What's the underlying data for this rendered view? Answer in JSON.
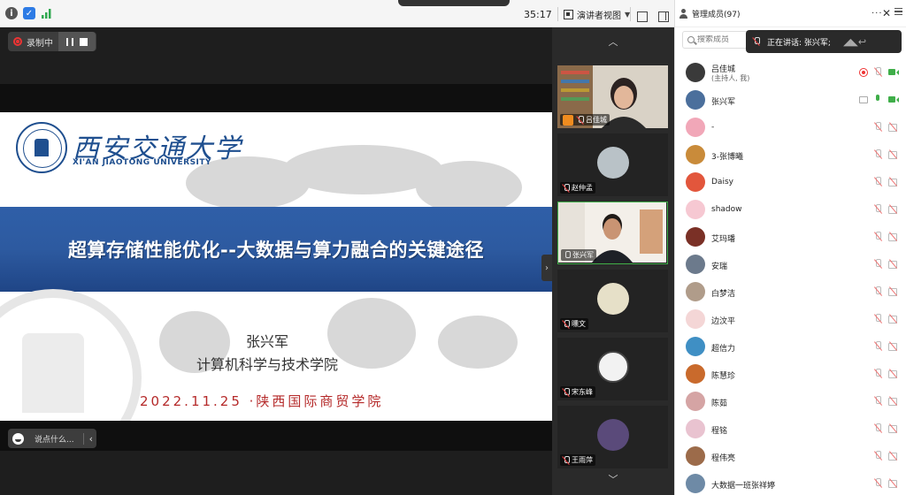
{
  "toolbar": {
    "timer": "35:17",
    "presenter_view_label": "演讲者视图"
  },
  "recording": {
    "label": "录制中"
  },
  "slide": {
    "university_cn": "西安交通大学",
    "university_en": "XI'AN JIAOTONG UNIVERSITY",
    "title": "超算存储性能优化--大数据与算力融合的关键途径",
    "presenter": "张兴军",
    "school": "计算机科学与技术学院",
    "date_venue": "2022.11.25 ·陕西国际商贸学院"
  },
  "chat": {
    "placeholder": "说点什么..."
  },
  "video_tiles": [
    {
      "name": "吕佳城",
      "kind": "video-host"
    },
    {
      "name": "赵仲孟",
      "kind": "avatar"
    },
    {
      "name": "张兴军",
      "kind": "video-active"
    },
    {
      "name": "曛文",
      "kind": "avatar"
    },
    {
      "name": "宋东峰",
      "kind": "avatar"
    },
    {
      "name": "王雨萍",
      "kind": "avatar"
    }
  ],
  "panel": {
    "title": "管理成员(97)",
    "search_placeholder": "搜索成员",
    "speaking_now": "正在讲话: 张兴军;",
    "members": [
      {
        "name": "吕佳城",
        "role": "(主持人, 我)",
        "color": "#3a3a3a",
        "status": "host"
      },
      {
        "name": "张兴军",
        "role": "",
        "color": "#4b6f9c",
        "status": "speaking"
      },
      {
        "name": "-",
        "role": "",
        "color": "#f1a7b8",
        "status": "muted"
      },
      {
        "name": "3-张博曦",
        "role": "",
        "color": "#c98b3a",
        "status": "muted"
      },
      {
        "name": "Daisy",
        "role": "",
        "color": "#e2563c",
        "status": "muted"
      },
      {
        "name": "shadow",
        "role": "",
        "color": "#f6c8d2",
        "status": "muted"
      },
      {
        "name": "艾玛璠",
        "role": "",
        "color": "#7a3026",
        "status": "muted"
      },
      {
        "name": "安瑞",
        "role": "",
        "color": "#6c7a8c",
        "status": "muted"
      },
      {
        "name": "白梦洁",
        "role": "",
        "color": "#b09c8a",
        "status": "muted"
      },
      {
        "name": "边汶平",
        "role": "",
        "color": "#f4d6d6",
        "status": "muted"
      },
      {
        "name": "超信力",
        "role": "",
        "color": "#3f8fc4",
        "status": "muted"
      },
      {
        "name": "陈慧珍",
        "role": "",
        "color": "#c96a2c",
        "status": "muted"
      },
      {
        "name": "陈茹",
        "role": "",
        "color": "#d5a4a4",
        "status": "muted"
      },
      {
        "name": "程铭",
        "role": "",
        "color": "#e9c3d0",
        "status": "muted"
      },
      {
        "name": "程伟亮",
        "role": "",
        "color": "#9c6b4a",
        "status": "muted"
      },
      {
        "name": "大数据一班张祥婷",
        "role": "",
        "color": "#6e8aa6",
        "status": "muted"
      }
    ]
  },
  "colors": {
    "accent_green": "#3fae49",
    "record_red": "#e33333",
    "title_band_blue": "#2d5aa0",
    "date_red": "#b52a2a"
  }
}
